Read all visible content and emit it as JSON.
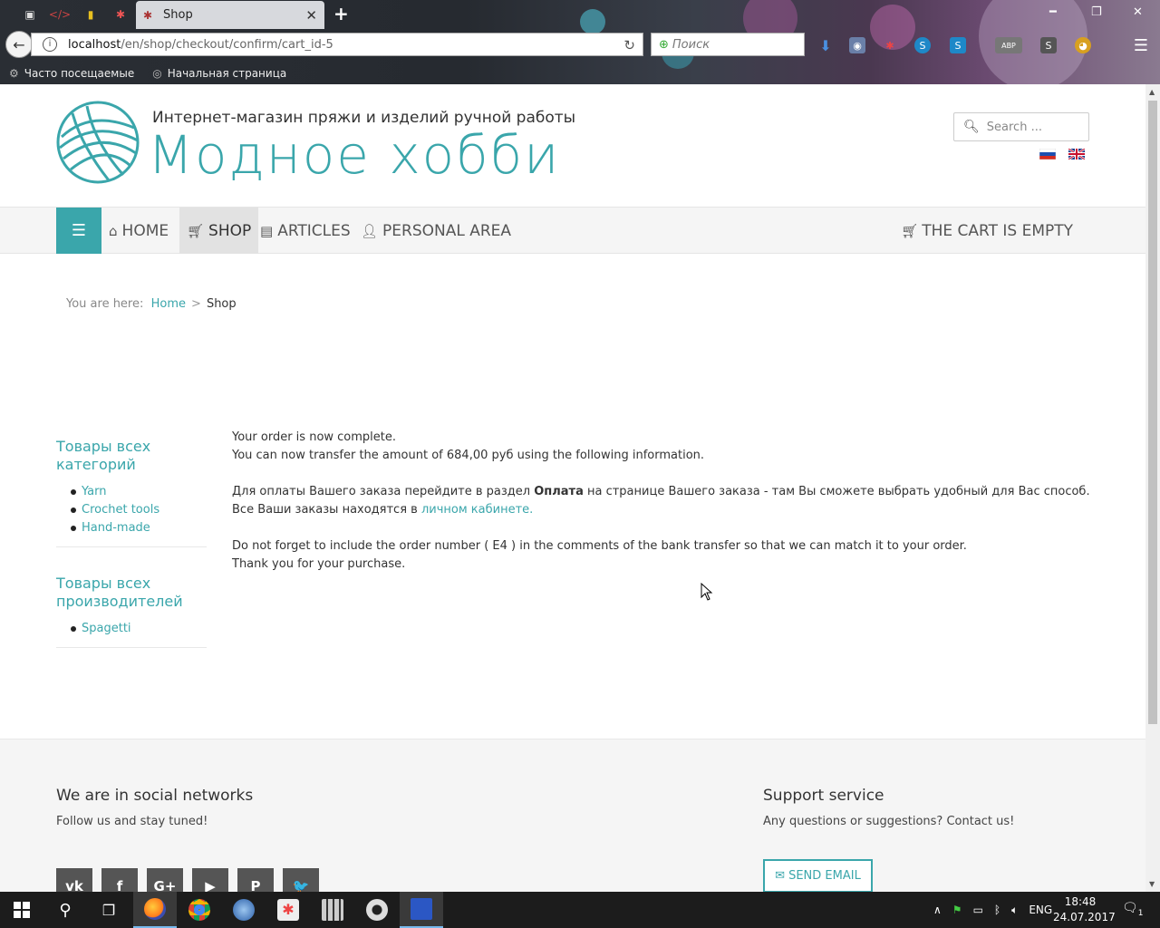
{
  "browser": {
    "tab_title": "Shop",
    "url_host": "localhost",
    "url_path": "/en/shop/checkout/confirm/cart_id-5",
    "search_placeholder": "Поиск",
    "bookmarks": [
      "Часто посещаемые",
      "Начальная страница"
    ]
  },
  "header": {
    "tagline": "Интернет-магазин пряжи и изделий ручной работы",
    "brand": "Модное хобби",
    "search_placeholder": "Search ...",
    "languages": [
      "ru",
      "en"
    ]
  },
  "nav": {
    "items": [
      {
        "label": "Home",
        "icon": "home-icon"
      },
      {
        "label": "Shop",
        "icon": "cart-icon",
        "active": true
      },
      {
        "label": "Articles",
        "icon": "document-icon"
      },
      {
        "label": "Personal area",
        "icon": "user-icon"
      }
    ],
    "cart_label": "The cart is empty"
  },
  "breadcrumb": {
    "prefix": "You are here:",
    "home": "Home",
    "current": "Shop"
  },
  "sidebar": {
    "categories_title": "Товары всех категорий",
    "categories": [
      "Yarn",
      "Crochet tools",
      "Hand-made"
    ],
    "manufacturers_title": "Товары всех производителей",
    "manufacturers": [
      "Spagetti"
    ]
  },
  "content": {
    "line1": "Your order is now complete.",
    "line2": "You can now transfer the amount of 684,00 руб using the following information.",
    "para_ru_a": "Для оплаты Вашего заказа перейдите в раздел ",
    "para_ru_bold": "Оплата",
    "para_ru_b": " на странице Вашего заказа - там Вы сможете выбрать удобный для Вас способ. Все Ваши заказы находятся в ",
    "para_ru_link": "личном кабинете.",
    "line3": "Do not forget to include the order number ( E4 ) in the comments of the bank transfer so that we can match it to your order.",
    "line4": "Thank you for your purchase."
  },
  "footer": {
    "social_title": "We are in social networks",
    "social_sub": "Follow us and stay tuned!",
    "social": [
      {
        "name": "vk-icon",
        "glyph": "vk"
      },
      {
        "name": "facebook-icon",
        "glyph": "f"
      },
      {
        "name": "google-plus-icon",
        "glyph": "G+"
      },
      {
        "name": "youtube-icon",
        "glyph": "▶"
      },
      {
        "name": "pinterest-icon",
        "glyph": "P"
      },
      {
        "name": "twitter-icon",
        "glyph": "🐦"
      }
    ],
    "support_title": "Support service",
    "support_sub": "Any questions or suggestions? Contact us!",
    "send_email": "SEND EMAIL"
  },
  "taskbar": {
    "lang": "ENG",
    "time": "18:48",
    "date": "24.07.2017",
    "notifications": "1"
  },
  "colors": {
    "accent": "#3aa6ab",
    "text": "#333333"
  }
}
